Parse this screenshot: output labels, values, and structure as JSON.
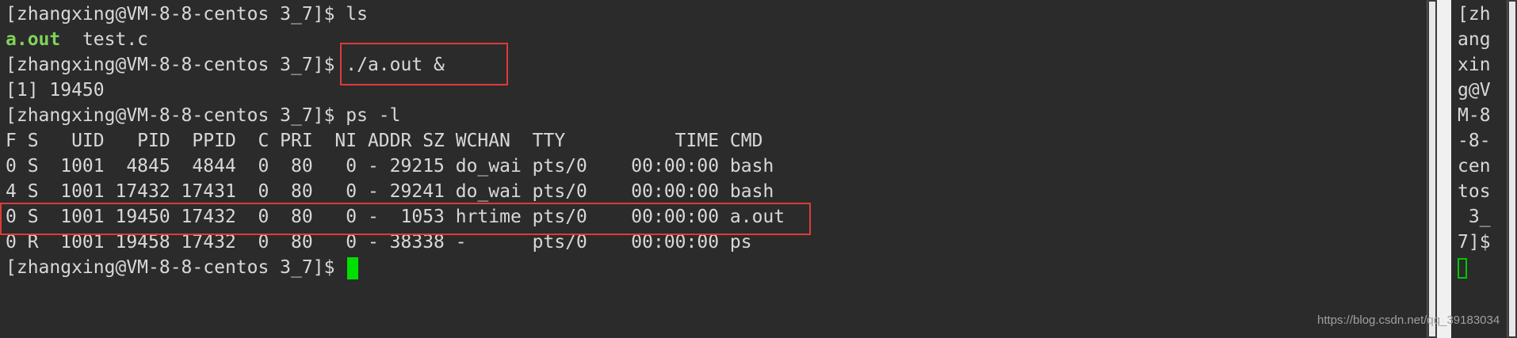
{
  "terminal": {
    "lines": [
      "[zhangxing@VM-8-8-centos 3_7]$ ls",
      {
        "exec": "a.out",
        "rest": "  test.c"
      },
      "[zhangxing@VM-8-8-centos 3_7]$ ./a.out &",
      "[1] 19450",
      "[zhangxing@VM-8-8-centos 3_7]$ ps -l",
      "F S   UID   PID  PPID  C PRI  NI ADDR SZ WCHAN  TTY          TIME CMD",
      "0 S  1001  4845  4844  0  80   0 - 29215 do_wai pts/0    00:00:00 bash",
      "4 S  1001 17432 17431  0  80   0 - 29241 do_wai pts/0    00:00:00 bash",
      "0 S  1001 19450 17432  0  80   0 -  1053 hrtime pts/0    00:00:00 a.out",
      "0 R  1001 19458 17432  0  80   0 - 38338 -      pts/0    00:00:00 ps",
      "[zhangxing@VM-8-8-centos 3_7]$ "
    ]
  },
  "side_terminal": {
    "lines": [
      "[zh",
      "ang",
      "xin",
      "g@V",
      "M-8",
      "-8-",
      "cen",
      "tos",
      " 3_",
      "7]$"
    ]
  },
  "watermark": "https://blog.csdn.net/qq_39183034",
  "colors": {
    "background": "#2b2b2b",
    "text": "#d8d8d8",
    "executable": "#7fd35a",
    "cursor": "#00e000",
    "highlight_border": "#e03a3a"
  }
}
